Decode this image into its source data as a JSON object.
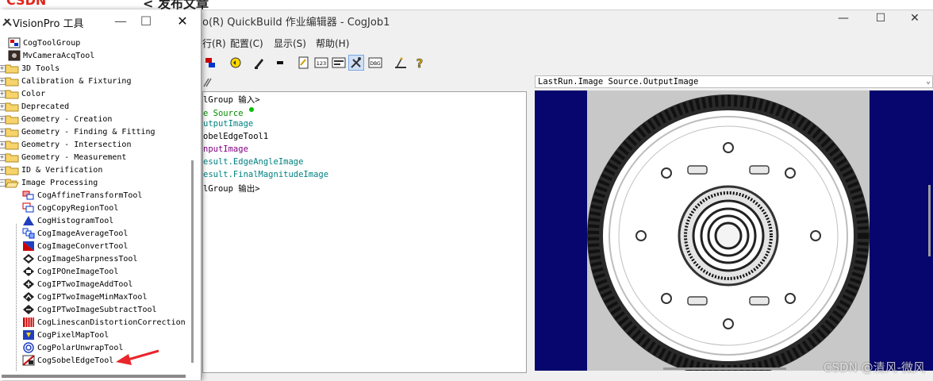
{
  "page": {
    "logo": "CSDN",
    "back_title": "< 发布文章"
  },
  "main_window": {
    "title": "o(R) QuickBuild 作业编辑器 - CogJob1",
    "minimize_glyph": "—",
    "maximize_glyph": "☐",
    "close_glyph": "✕",
    "menu": [
      {
        "label": "行(R)"
      },
      {
        "label": "配置(C)"
      },
      {
        "label": "显示(S)"
      },
      {
        "label": "帮助(H)"
      }
    ],
    "toolbar_icons": [
      "run-job-icon",
      "run-continuous-icon",
      "brush-icon",
      "stop-icon",
      "script-icon",
      "numbers-icon",
      "image-icon",
      "tools-icon",
      "dbg-icon",
      "measure-icon",
      "help-icon"
    ],
    "toolbar_text": {
      "numbers": "123",
      "dbg": "DBG",
      "help": "?"
    }
  },
  "script": {
    "lines": [
      {
        "text": "lGroup 输入>",
        "color": "#000000"
      },
      {
        "text": "e Source",
        "color": "#008c00"
      },
      {
        "text": "utputImage",
        "color": "#008080"
      },
      {
        "text": "obelEdgeTool1",
        "color": "#000000"
      },
      {
        "text": "nputImage",
        "color": "#800080"
      },
      {
        "text": "esult.EdgeAngleImage",
        "color": "#008080"
      },
      {
        "text": "esult.FinalMagnitudeImage",
        "color": "#008080"
      },
      {
        "text": "lGroup 输出>",
        "color": "#000000"
      }
    ]
  },
  "image_panel": {
    "selected": "LastRun.Image Source.OutputImage",
    "background": "#06066e"
  },
  "toolbox": {
    "title": "VisionPro 工具",
    "min_glyph": "—",
    "max_glyph": "☐",
    "close_glyph": "✕",
    "items": [
      {
        "label": "CogToolGroup",
        "icon": "tool-group-icon",
        "level": 1
      },
      {
        "label": "MvCameraAcqTool",
        "icon": "camera-icon",
        "level": 1
      },
      {
        "label": "3D Tools",
        "icon": "folder-icon",
        "level": 0
      },
      {
        "label": "Calibration & Fixturing",
        "icon": "folder-icon",
        "level": 0
      },
      {
        "label": "Color",
        "icon": "folder-icon",
        "level": 0
      },
      {
        "label": "Deprecated",
        "icon": "folder-icon",
        "level": 0
      },
      {
        "label": "Geometry - Creation",
        "icon": "folder-icon",
        "level": 0
      },
      {
        "label": "Geometry - Finding & Fitting",
        "icon": "folder-icon",
        "level": 0
      },
      {
        "label": "Geometry - Intersection",
        "icon": "folder-icon",
        "level": 0
      },
      {
        "label": "Geometry - Measurement",
        "icon": "folder-icon",
        "level": 0
      },
      {
        "label": "ID & Verification",
        "icon": "folder-icon",
        "level": 0
      },
      {
        "label": "Image Processing",
        "icon": "folder-open-icon",
        "level": 0
      },
      {
        "label": "CogAffineTransformTool",
        "icon": "affine-transform-icon",
        "level": 2
      },
      {
        "label": "CogCopyRegionTool",
        "icon": "copy-region-icon",
        "level": 2
      },
      {
        "label": "CogHistogramTool",
        "icon": "histogram-icon",
        "level": 2
      },
      {
        "label": "CogImageAverageTool",
        "icon": "image-average-icon",
        "level": 2
      },
      {
        "label": "CogImageConvertTool",
        "icon": "image-convert-icon",
        "level": 2
      },
      {
        "label": "CogImageSharpnessTool",
        "icon": "image-sharpness-icon",
        "level": 2
      },
      {
        "label": "CogIPOneImageTool",
        "icon": "ip-one-image-icon",
        "level": 2
      },
      {
        "label": "CogIPTwoImageAddTool",
        "icon": "ip-two-image-add-icon",
        "level": 2
      },
      {
        "label": "CogIPTwoImageMinMaxTool",
        "icon": "ip-two-image-minmax-icon",
        "level": 2
      },
      {
        "label": "CogIPTwoImageSubtractTool",
        "icon": "ip-two-image-subtract-icon",
        "level": 2
      },
      {
        "label": "CogLinescanDistortionCorrection",
        "icon": "linescan-icon",
        "level": 2
      },
      {
        "label": "CogPixelMapTool",
        "icon": "pixel-map-icon",
        "level": 2
      },
      {
        "label": "CogPolarUnwrapTool",
        "icon": "polar-unwrap-icon",
        "level": 2
      },
      {
        "label": "CogSobelEdgeTool",
        "icon": "sobel-edge-icon",
        "level": 2
      }
    ]
  },
  "watermark": "CSDN @清风-微风"
}
